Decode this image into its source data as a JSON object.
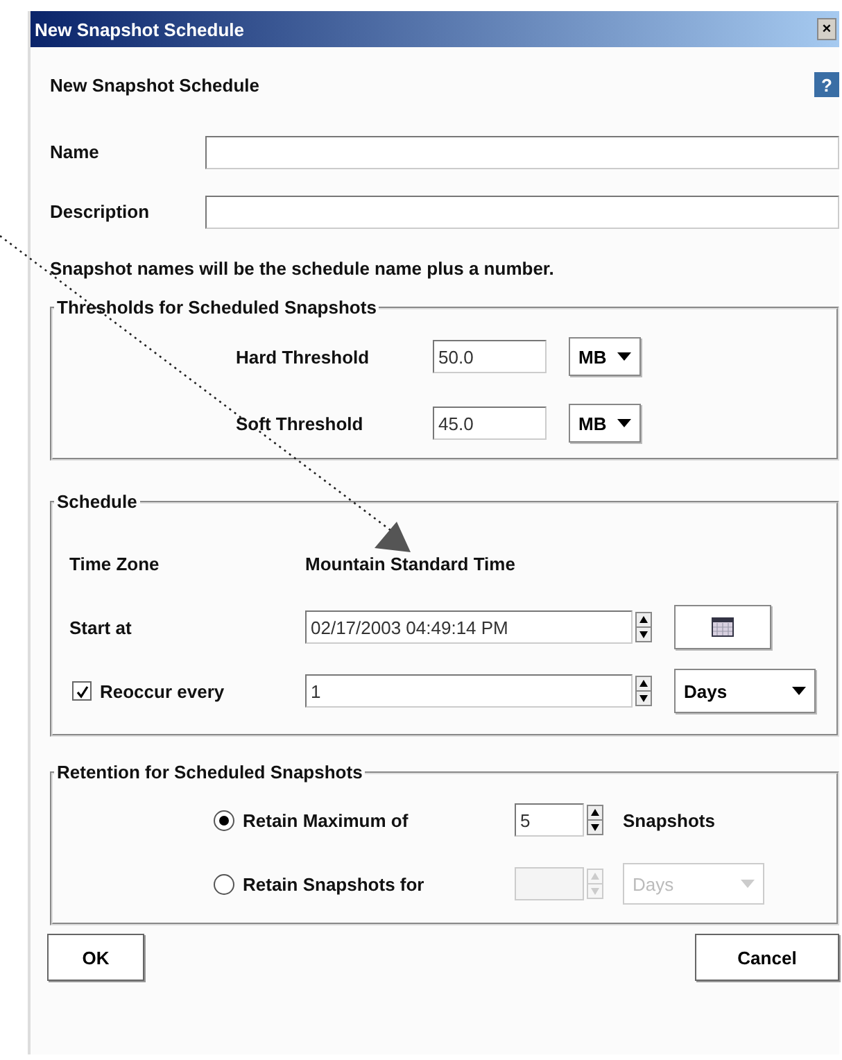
{
  "window": {
    "title": "New Snapshot Schedule",
    "close": "×"
  },
  "heading": "New Snapshot Schedule",
  "help_button": "?",
  "fields": [
    {
      "label": "Name"
    },
    {
      "label": "Description"
    }
  ],
  "note": "Snapshot names will be the schedule name plus a number.",
  "thresholds": {
    "title": "Thresholds for Scheduled Snapshots",
    "rows": [
      {
        "label": "Hard Threshold",
        "value": "50.0",
        "unit": "MB"
      },
      {
        "label": "Soft Threshold",
        "value": "45.0",
        "unit": "MB"
      }
    ]
  },
  "schedule": {
    "title": "Schedule",
    "time_zone_label": "Time Zone",
    "time_zone": "Mountain Standard Time",
    "start_label": "Start at",
    "start_value": "02/17/2003 04:49:14 PM",
    "reoccur": {
      "label": "Reoccur every",
      "checked": true,
      "value": "1",
      "unit": "Days"
    }
  },
  "retention": {
    "title": "Retention for Scheduled Snapshots",
    "options": [
      {
        "kind": "count",
        "label": "Retain Maximum of",
        "selected": true,
        "disabled": false,
        "value": "5",
        "suffix": "Snapshots"
      },
      {
        "kind": "duration",
        "label": "Retain Snapshots for",
        "selected": false,
        "disabled": true,
        "unit": "Days"
      }
    ]
  },
  "buttons": [
    "OK",
    "Cancel"
  ]
}
